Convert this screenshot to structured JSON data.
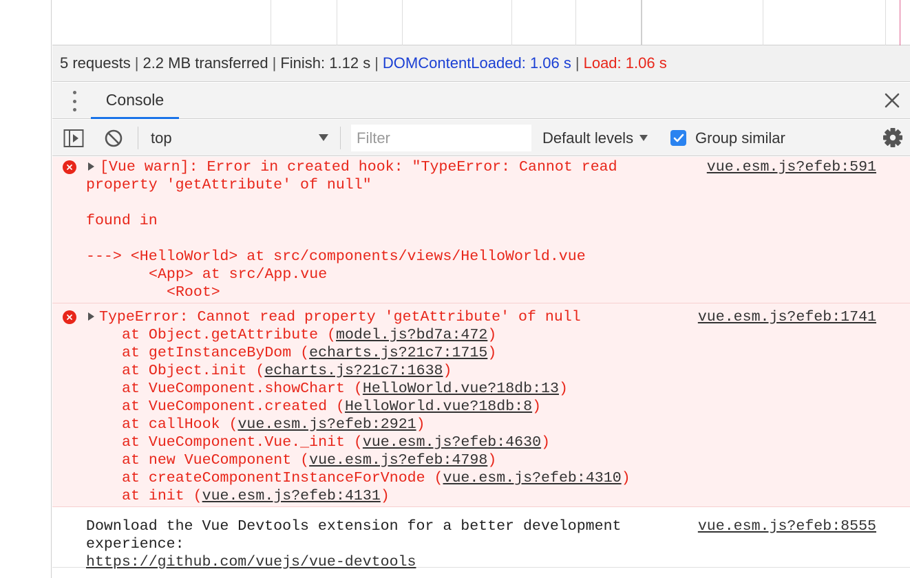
{
  "network": {
    "summary": {
      "requests": "5 requests",
      "transferred": "2.2 MB transferred",
      "finish": "Finish: 1.12 s",
      "dom_content_loaded": "DOMContentLoaded: 1.06 s",
      "load": "Load: 1.06 s",
      "separator": "|"
    }
  },
  "drawer": {
    "tabs": [
      {
        "label": "Console",
        "active": true
      }
    ],
    "menu_icon": "kebab-menu-icon",
    "close_icon": "close-icon"
  },
  "toolbar": {
    "context": "top",
    "filter_placeholder": "Filter",
    "levels": "Default levels",
    "group_similar": "Group similar",
    "group_similar_checked": true
  },
  "messages": [
    {
      "level": "error",
      "source": "vue.esm.js?efeb:591",
      "lines": [
        "[Vue warn]: Error in created hook: \"TypeError: Cannot read",
        "property 'getAttribute' of null\"",
        "found in",
        "---> <HelloWorld> at src/components/views/HelloWorld.vue",
        "<App> at src/App.vue",
        "<Root>"
      ]
    },
    {
      "level": "error",
      "source": "vue.esm.js?efeb:1741",
      "head": "TypeError: Cannot read property 'getAttribute' of null",
      "stack": [
        {
          "fn": "at Object.getAttribute",
          "loc": "model.js?bd7a:472"
        },
        {
          "fn": "at getInstanceByDom",
          "loc": "echarts.js?21c7:1715"
        },
        {
          "fn": "at Object.init",
          "loc": "echarts.js?21c7:1638"
        },
        {
          "fn": "at VueComponent.showChart",
          "loc": "HelloWorld.vue?18db:13"
        },
        {
          "fn": "at VueComponent.created",
          "loc": "HelloWorld.vue?18db:8"
        },
        {
          "fn": "at callHook",
          "loc": "vue.esm.js?efeb:2921"
        },
        {
          "fn": "at VueComponent.Vue._init",
          "loc": "vue.esm.js?efeb:4630"
        },
        {
          "fn": "at new VueComponent",
          "loc": "vue.esm.js?efeb:4798"
        },
        {
          "fn": "at createComponentInstanceForVnode",
          "loc": "vue.esm.js?efeb:4310"
        },
        {
          "fn": "at init",
          "loc": "vue.esm.js?efeb:4131"
        }
      ]
    },
    {
      "level": "info",
      "source": "vue.esm.js?efeb:8555",
      "lines": [
        "Download the Vue Devtools extension for a better development",
        "experience:"
      ],
      "link": "https://github.com/vuejs/vue-devtools"
    }
  ],
  "colors": {
    "error_text": "#e8261a",
    "error_bg": "#fff0f0",
    "blue_metric": "#1a3fd4",
    "active_tab": "#1a73e8",
    "checkbox": "#2a83f0"
  }
}
